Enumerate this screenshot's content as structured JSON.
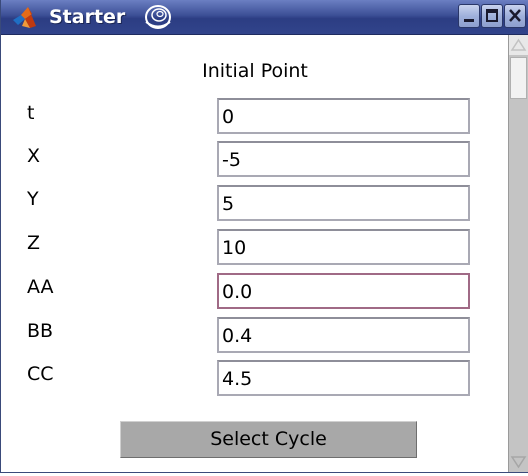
{
  "window": {
    "title": "Starter",
    "app_icon": "matlab-icon",
    "title_decoration_icon": "swirl-icon",
    "controls": [
      "minimize-icon",
      "maximize-icon",
      "close-icon"
    ]
  },
  "form": {
    "heading": "Initial Point",
    "fields": [
      {
        "label": "t",
        "value": "0"
      },
      {
        "label": "X",
        "value": "-5"
      },
      {
        "label": "Y",
        "value": "5"
      },
      {
        "label": "Z",
        "value": "10"
      },
      {
        "label": "AA",
        "value": "0.0"
      },
      {
        "label": "BB",
        "value": "0.4"
      },
      {
        "label": "CC",
        "value": "4.5"
      }
    ],
    "action_button": "Select Cycle"
  },
  "colors": {
    "titlebar": "#3c4f96",
    "focused_field_border": "#a06a86",
    "button_face": "#a8a8a8",
    "scrollbar_track": "#c4c4c4"
  }
}
